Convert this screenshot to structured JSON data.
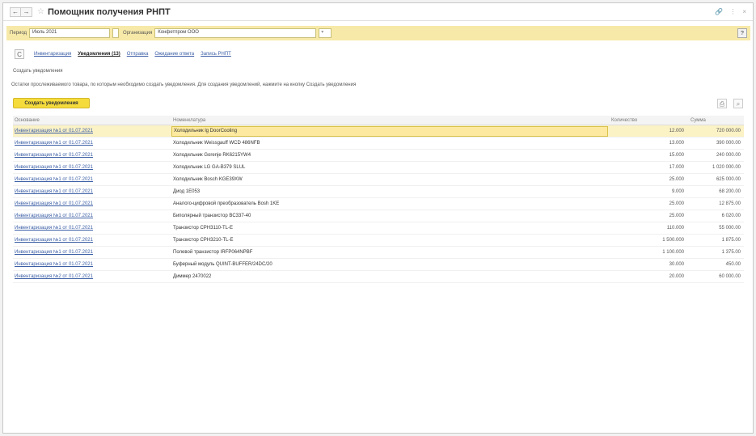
{
  "window": {
    "title": "Помощник получения РНПТ",
    "nav_back": "←",
    "nav_forward": "→",
    "star": "☆",
    "ctrl_link": "🔗",
    "ctrl_menu": "⋮",
    "ctrl_close": "×"
  },
  "filters": {
    "period_label": "Период",
    "period_value": "Июль 2021",
    "org_label": "Организация",
    "org_value": "Конфетпром ООО",
    "help": "?"
  },
  "tabs": {
    "refresh": "C",
    "items": [
      "Инвентаризация",
      "Уведомления (13)",
      "Отправка",
      "Ожидание ответа",
      "Запись РНПТ"
    ]
  },
  "section_title": "Создать уведомления",
  "hint": "Остатки прослеживаемого товара, по которым необходимо создать уведомления. Для создания уведомлений, нажмите на кнопку Создать уведомления",
  "create_button": "Создать уведомления",
  "table": {
    "headers": [
      "Основание",
      "Номенклатура",
      "Количество",
      "Сумма"
    ],
    "rows": [
      [
        "Инвентаризация №1 от 01.07.2021",
        "Холодильник lg DoorCooling",
        "12.000",
        "720 000.00"
      ],
      [
        "Инвентаризация №1 от 01.07.2021",
        "Холодильник Weissgauff WCD 486NFB",
        "13.000",
        "390 000.00"
      ],
      [
        "Инвентаризация №1 от 01.07.2021",
        "Холодильник Gorenje RK6215YW4",
        "15.000",
        "240 000.00"
      ],
      [
        "Инвентаризация №1 от 01.07.2021",
        "Холодильник LG GA-B379 SLUL",
        "17.000",
        "1 020 000.00"
      ],
      [
        "Инвентаризация №1 от 01.07.2021",
        "Холодильник Bosch KGE39XW",
        "25.000",
        "625 000.00"
      ],
      [
        "Инвентаризация №1 от 01.07.2021",
        "Диод 1E053",
        "9.000",
        "68 200.00"
      ],
      [
        "Инвентаризация №1 от 01.07.2021",
        "Аналого-цифровой преобразователь Bosh 1KE",
        "25.000",
        "12 875.00"
      ],
      [
        "Инвентаризация №1 от 01.07.2021",
        "Биполярный транзистор BC337-40",
        "25.000",
        "6 020.00"
      ],
      [
        "Инвентаризация №1 от 01.07.2021",
        "Транзистор CPH3110-TL-E",
        "110.000",
        "55 000.00"
      ],
      [
        "Инвентаризация №1 от 01.07.2021",
        "Транзистор CPH3210-TL-E",
        "1 500.000",
        "1 875.00"
      ],
      [
        "Инвентаризация №1 от 01.07.2021",
        "Полевой транзистор IRFP064NPBF",
        "1 100.000",
        "1 375.00"
      ],
      [
        "Инвентаризация №1 от 01.07.2021",
        "Буферный модуль QUINT-BUFFER/24DC/20",
        "30.000",
        "450.00"
      ],
      [
        "Инвентаризация №2 от 01.07.2021",
        "Диммер 2470022",
        "20.000",
        "60 000.00"
      ]
    ]
  }
}
